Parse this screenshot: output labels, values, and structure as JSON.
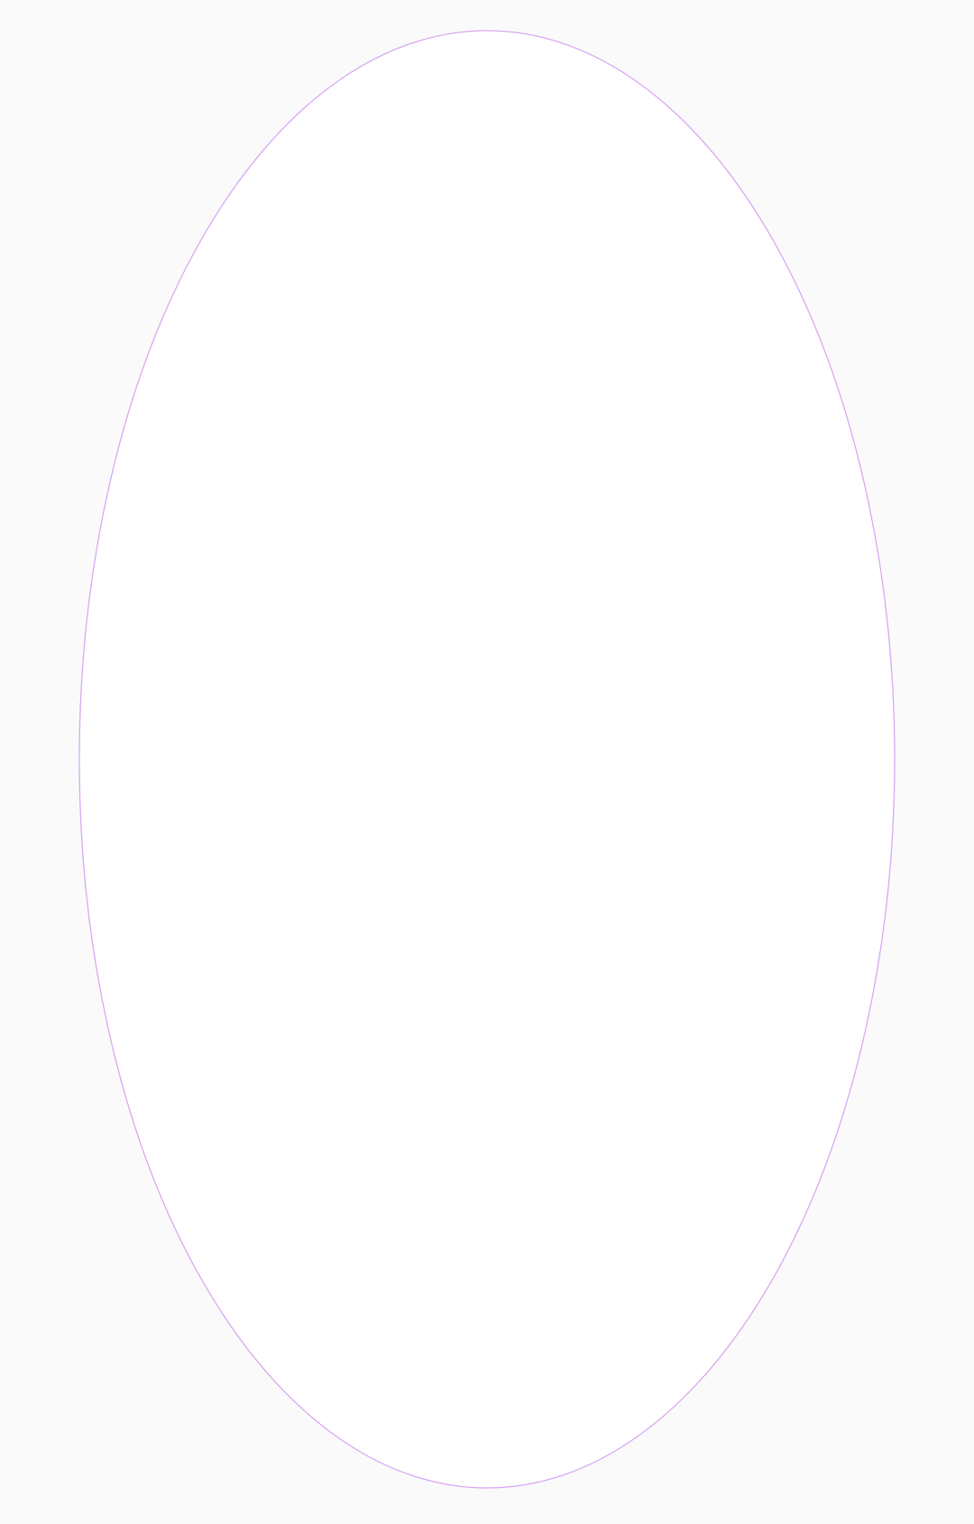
{
  "page": {
    "background_color": "#fafafa"
  },
  "shape": {
    "kind": "ellipse",
    "fill_color": "#ffffff",
    "stroke_color": "#d9a8f2"
  }
}
